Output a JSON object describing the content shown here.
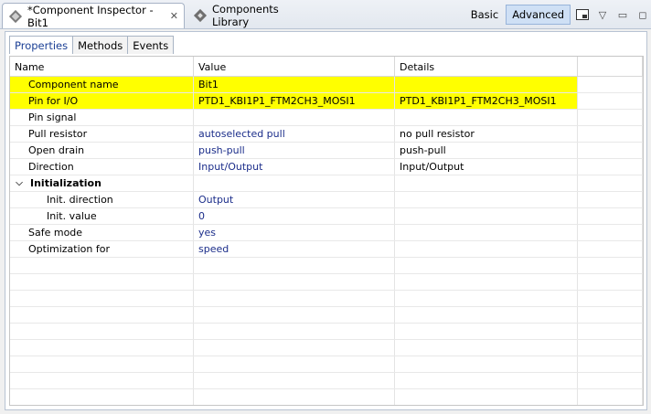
{
  "tabs": [
    {
      "label": "*Component Inspector - Bit1",
      "icon": "component-icon",
      "closable": true
    },
    {
      "label": "Components Library",
      "icon": "library-icon"
    }
  ],
  "view_modes": {
    "basic": "Basic",
    "advanced": "Advanced",
    "selected": "Advanced"
  },
  "subtabs": [
    "Properties",
    "Methods",
    "Events"
  ],
  "columns": [
    "Name",
    "Value",
    "Details"
  ],
  "rows": [
    {
      "name": "Component name",
      "value": "Bit1",
      "details": "",
      "highlight": true
    },
    {
      "name": "Pin for I/O",
      "value": "PTD1_KBI1P1_FTM2CH3_MOSI1",
      "details": "PTD1_KBI1P1_FTM2CH3_MOSI1",
      "highlight": true
    },
    {
      "name": "Pin signal",
      "value": "",
      "details": ""
    },
    {
      "name": "Pull resistor",
      "value": "autoselected pull",
      "details": "no pull resistor"
    },
    {
      "name": "Open drain",
      "value": "push-pull",
      "details": "push-pull"
    },
    {
      "name": "Direction",
      "value": "Input/Output",
      "details": "Input/Output"
    },
    {
      "name": "Initialization",
      "value": "",
      "details": "",
      "group": true
    },
    {
      "name": "Init. direction",
      "value": "Output",
      "details": "",
      "level": 2
    },
    {
      "name": "Init. value",
      "value": "0",
      "details": "",
      "level": 2
    },
    {
      "name": "Safe mode",
      "value": "yes",
      "details": ""
    },
    {
      "name": "Optimization for",
      "value": "speed",
      "details": ""
    }
  ],
  "colors": {
    "highlight": "#ffff00",
    "value_text": "#1b2d8a",
    "active_subtab": "#1a3f95"
  }
}
